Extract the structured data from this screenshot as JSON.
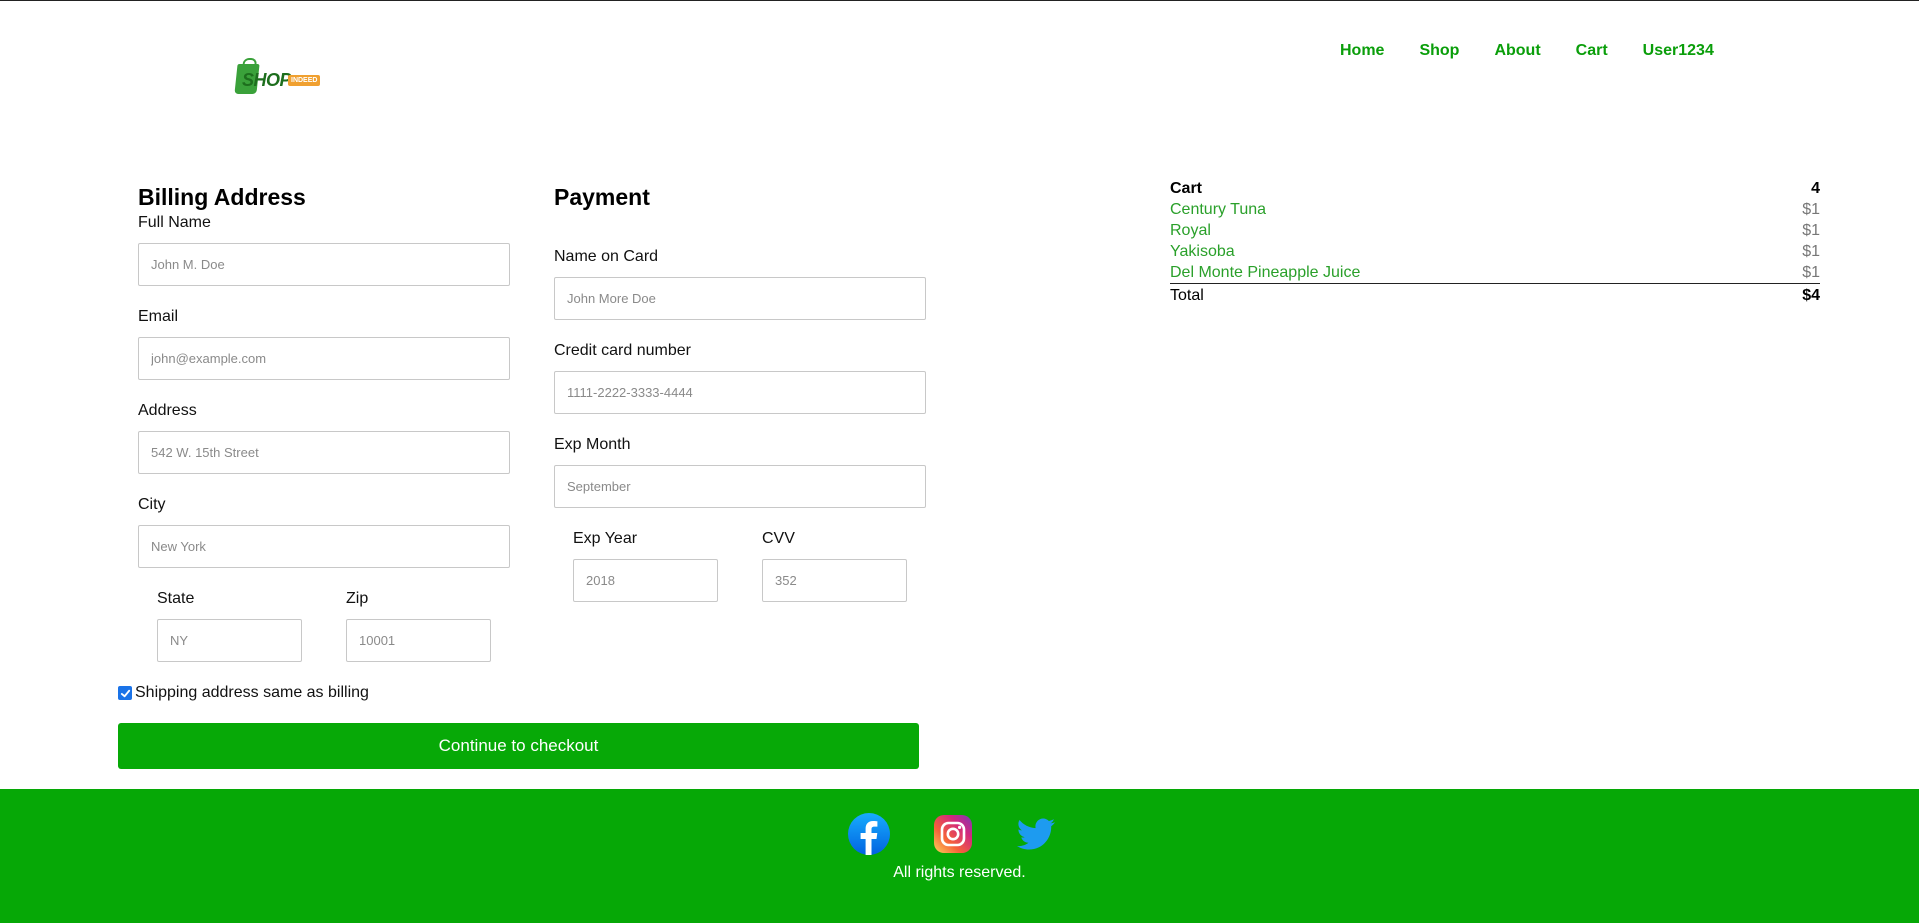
{
  "header": {
    "logo_text": "SHOP",
    "logo_tag": "INDEED",
    "nav": [
      "Home",
      "Shop",
      "About",
      "Cart",
      "User1234"
    ]
  },
  "billing": {
    "title": "Billing Address",
    "full_name": {
      "label": "Full Name",
      "placeholder": "John M. Doe"
    },
    "email": {
      "label": "Email",
      "placeholder": "john@example.com"
    },
    "address": {
      "label": "Address",
      "placeholder": "542 W. 15th Street"
    },
    "city": {
      "label": "City",
      "placeholder": "New York"
    },
    "state": {
      "label": "State",
      "placeholder": "NY"
    },
    "zip": {
      "label": "Zip",
      "placeholder": "10001"
    }
  },
  "payment": {
    "title": "Payment",
    "name_on_card": {
      "label": "Name on Card",
      "placeholder": "John More Doe"
    },
    "card_number": {
      "label": "Credit card number",
      "placeholder": "1111-2222-3333-4444"
    },
    "exp_month": {
      "label": "Exp Month",
      "placeholder": "September"
    },
    "exp_year": {
      "label": "Exp Year",
      "placeholder": "2018"
    },
    "cvv": {
      "label": "CVV",
      "placeholder": "352"
    }
  },
  "shipping_same": {
    "label": "Shipping address same as billing",
    "checked": true
  },
  "checkout_button": "Continue to checkout",
  "cart": {
    "title": "Cart",
    "count": "4",
    "items": [
      {
        "name": "Century Tuna",
        "price": "$1"
      },
      {
        "name": "Royal",
        "price": "$1"
      },
      {
        "name": "Yakisoba",
        "price": "$1"
      },
      {
        "name": "Del Monte Pineapple Juice",
        "price": "$1"
      }
    ],
    "total_label": "Total",
    "total_value": "$4"
  },
  "footer": {
    "social": [
      "facebook-icon",
      "instagram-icon",
      "twitter-icon"
    ],
    "copyright": "All rights reserved."
  },
  "colors": {
    "accent": "#07a907",
    "nav_link": "#0a9e0a",
    "cart_item": "#2aa02a",
    "checkbox": "#1a73e8"
  }
}
